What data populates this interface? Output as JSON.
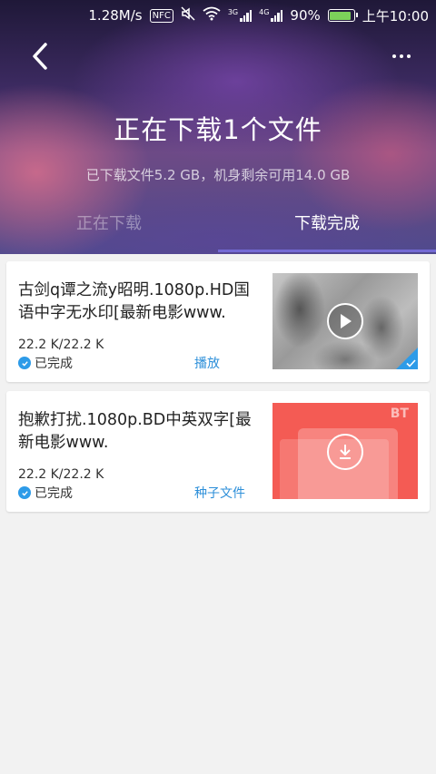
{
  "status_bar": {
    "speed": "1.28M/s",
    "nfc": "NFC",
    "signal_3g": "3G",
    "signal_4g": "4G",
    "battery": "90%",
    "battery_level": 0.9,
    "time": "上午10:00"
  },
  "header": {
    "title": "正在下载1个文件",
    "storage": "已下载文件5.2 GB，机身剩余可用14.0 GB",
    "tabs": [
      {
        "label": "正在下载",
        "active": false
      },
      {
        "label": "下载完成",
        "active": true
      }
    ]
  },
  "downloads": [
    {
      "title": "古剑q谭之流y昭明.1080p.HD国语中字无水印[最新电影www.",
      "size": "22.2 K/22.2 K",
      "status": "已完成",
      "action": "播放",
      "thumb": "video-thumbnail"
    },
    {
      "title": "抱歉打扰.1080p.BD中英双字[最新电影www.",
      "size": "22.2 K/22.2 K",
      "status": "已完成",
      "action": "种子文件",
      "thumb": "bt-torrent",
      "thumb_label": "BT"
    }
  ],
  "colors": {
    "accent": "#2d8fd9",
    "check": "#2d9be8",
    "bt_thumb": "#f45b54"
  }
}
